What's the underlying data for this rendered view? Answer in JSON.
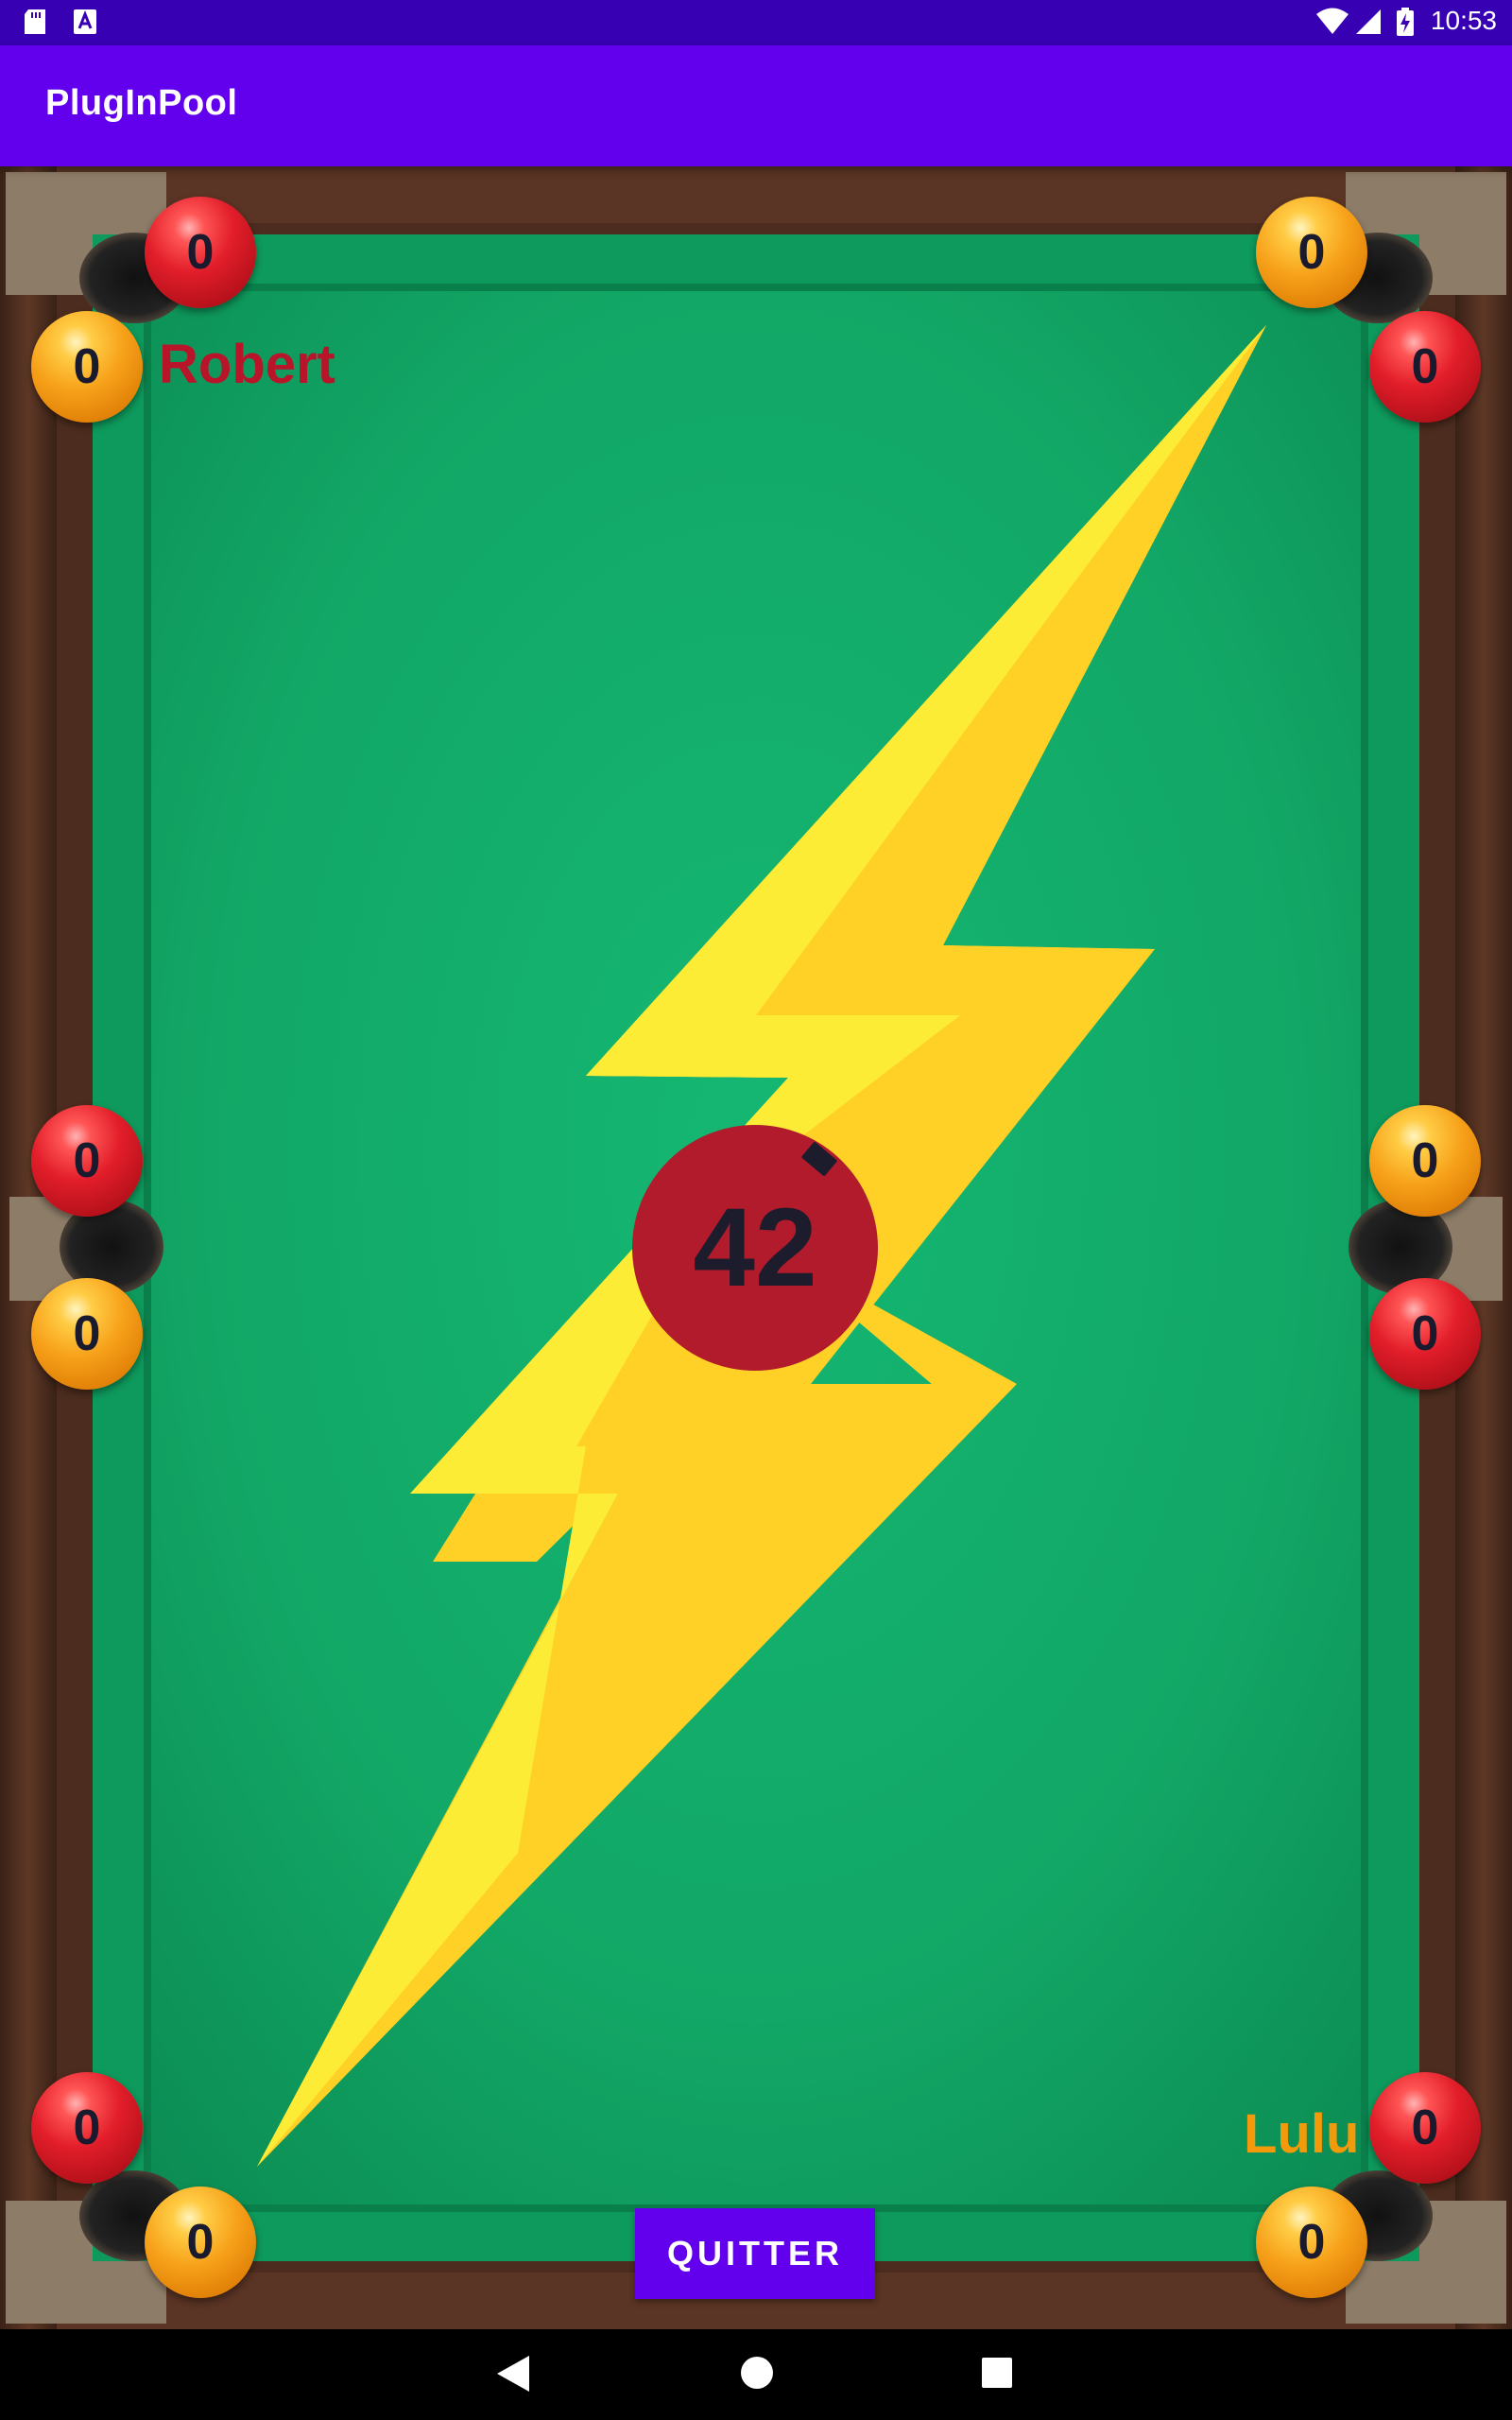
{
  "status_bar": {
    "time": "10:53",
    "left_icons": [
      "sd-card-icon",
      "text-notification-icon"
    ],
    "right_icons": [
      "wifi-icon",
      "signal-icon",
      "battery-charging-icon"
    ]
  },
  "app_bar": {
    "title": "PlugInPool"
  },
  "players": {
    "top_left": {
      "name": "Robert",
      "color": "#b8142a"
    },
    "bottom_right": {
      "name": "Lulu",
      "color": "#f39a0a"
    }
  },
  "balls": {
    "tl_top": "0",
    "tl_side": "0",
    "tr_top": "0",
    "tr_side": "0",
    "ml_upper": "0",
    "ml_lower": "0",
    "mr_upper": "0",
    "mr_lower": "0",
    "bl_side": "0",
    "bl_bottom": "0",
    "br_side": "0",
    "br_bottom": "0"
  },
  "timer": {
    "value": "42",
    "color": "#b21b2b"
  },
  "quit_button": {
    "label": "QUITTER"
  },
  "nav_bar": {
    "buttons": [
      "back-icon",
      "home-icon",
      "recents-icon"
    ]
  },
  "colors": {
    "status_bar": "#3700b3",
    "app_bar": "#6200ee",
    "felt": "#14b06f",
    "bolt": "#ffe033"
  }
}
